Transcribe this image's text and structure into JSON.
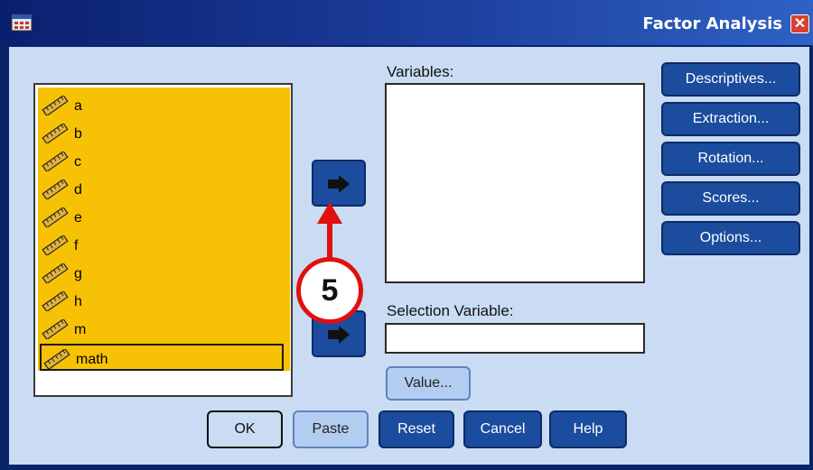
{
  "window": {
    "title": "Factor Analysis",
    "close_glyph": "✕",
    "accent": "#0a246a",
    "client_bg": "#c9dcf3"
  },
  "variables_list": {
    "items": [
      {
        "label": "a",
        "icon": "ruler-icon"
      },
      {
        "label": "b",
        "icon": "ruler-icon"
      },
      {
        "label": "c",
        "icon": "ruler-icon"
      },
      {
        "label": "d",
        "icon": "ruler-icon"
      },
      {
        "label": "e",
        "icon": "ruler-icon"
      },
      {
        "label": "f",
        "icon": "ruler-icon"
      },
      {
        "label": "g",
        "icon": "ruler-icon"
      },
      {
        "label": "h",
        "icon": "ruler-icon"
      },
      {
        "label": "m",
        "icon": "ruler-icon"
      },
      {
        "label": "math",
        "icon": "ruler-icon",
        "selected": true
      }
    ],
    "highlight_color": "#f7c205"
  },
  "variables_box": {
    "label": "Variables:"
  },
  "selection": {
    "label": "Selection Variable:",
    "value": ""
  },
  "value_button": {
    "label": "Value..."
  },
  "side_buttons": {
    "descriptives": "Descriptives...",
    "extraction": "Extraction...",
    "rotation": "Rotation...",
    "scores": "Scores...",
    "options": "Options..."
  },
  "bottom_buttons": {
    "ok": "OK",
    "paste": "Paste",
    "reset": "Reset",
    "cancel": "Cancel",
    "help": "Help"
  },
  "annotation": {
    "step": "5",
    "color": "#e01010"
  }
}
